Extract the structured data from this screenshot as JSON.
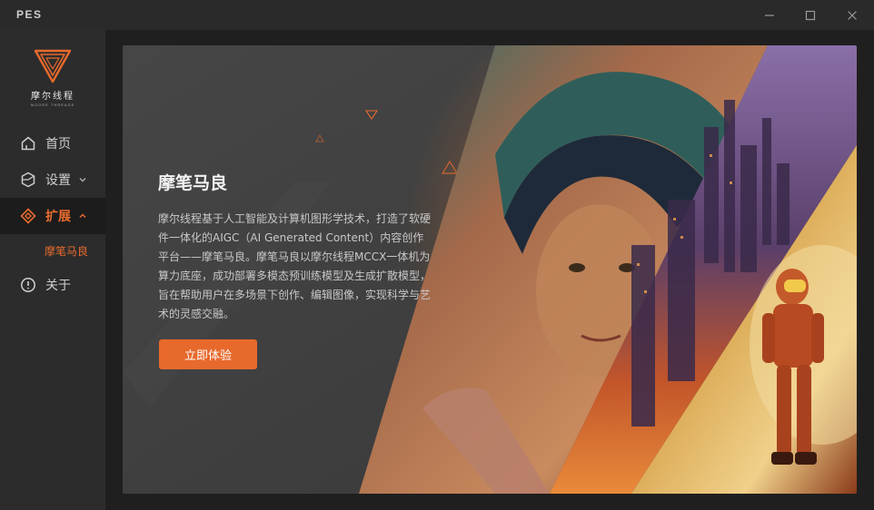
{
  "window": {
    "title": "PES"
  },
  "brand": {
    "name": "摩尔线程",
    "sub": "MOORE THREADS",
    "accent": "#e8692c"
  },
  "sidebar": {
    "items": [
      {
        "label": "首页",
        "icon": "home-icon",
        "active": false
      },
      {
        "label": "设置",
        "icon": "settings-hexagon-icon",
        "expandable": true,
        "expanded": false
      },
      {
        "label": "扩展",
        "icon": "extension-icon",
        "expandable": true,
        "expanded": true,
        "active": true
      },
      {
        "label": "关于",
        "icon": "info-icon",
        "active": false
      }
    ],
    "sub_items": [
      {
        "label": "摩笔马良",
        "parent": "扩展",
        "selected": true
      }
    ]
  },
  "main": {
    "title": "摩笔马良",
    "description": "摩尔线程基于人工智能及计算机图形学技术，打造了软硬件一体化的AIGC（AI Generated Content）内容创作平台——摩笔马良。摩笔马良以摩尔线程MCCX一体机为算力底座，成功部署多模态预训练模型及生成扩散模型，旨在帮助用户在多场景下创作、编辑图像，实现科学与艺术的灵感交融。",
    "cta_label": "立即体验"
  }
}
